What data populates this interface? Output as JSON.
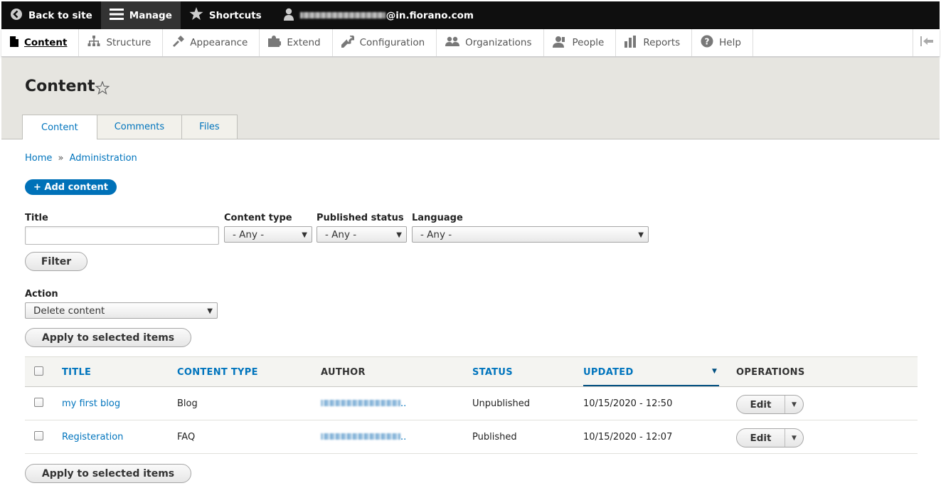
{
  "toolbar": {
    "back_label": "Back to site",
    "manage_label": "Manage",
    "shortcuts_label": "Shortcuts",
    "user_domain": "@in.fiorano.com"
  },
  "tray": {
    "items": [
      {
        "label": "Content"
      },
      {
        "label": "Structure"
      },
      {
        "label": "Appearance"
      },
      {
        "label": "Extend"
      },
      {
        "label": "Configuration"
      },
      {
        "label": "Organizations"
      },
      {
        "label": "People"
      },
      {
        "label": "Reports"
      },
      {
        "label": "Help"
      }
    ]
  },
  "page": {
    "title": "Content",
    "tabs": [
      "Content",
      "Comments",
      "Files"
    ]
  },
  "breadcrumb": {
    "home": "Home",
    "sep": "»",
    "admin": "Administration"
  },
  "add_button": "+ Add content",
  "filters": {
    "title_label": "Title",
    "title_value": "",
    "content_type_label": "Content type",
    "content_type_value": "- Any -",
    "published_label": "Published status",
    "published_value": "- Any -",
    "language_label": "Language",
    "language_value": "- Any -",
    "filter_button": "Filter"
  },
  "action": {
    "label": "Action",
    "value": "Delete content",
    "apply_label": "Apply to selected items"
  },
  "table": {
    "headers": {
      "title": "TITLE",
      "content_type": "CONTENT TYPE",
      "author": "AUTHOR",
      "status": "STATUS",
      "updated": "UPDATED",
      "operations": "OPERATIONS"
    },
    "rows": [
      {
        "title": "my first blog",
        "type": "Blog",
        "author_suffix": "..",
        "status": "Unpublished",
        "updated": "10/15/2020 - 12:50",
        "op": "Edit"
      },
      {
        "title": "Registeration",
        "type": "FAQ",
        "author_suffix": "..",
        "status": "Published",
        "updated": "10/15/2020 - 12:07",
        "op": "Edit"
      }
    ]
  },
  "colors": {
    "link": "#0074bd",
    "primary_button": "#0071b8",
    "toolbar": "#0f0f0f",
    "header_bg": "#e6e5e0"
  }
}
